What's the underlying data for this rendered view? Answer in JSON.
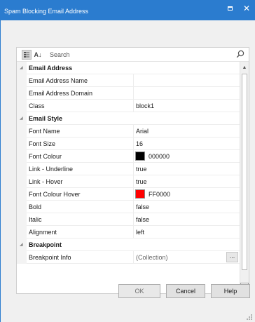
{
  "window": {
    "title": "Spam Blocking Email Address",
    "maximize_icon": "maximize-icon",
    "close_icon": "close-icon",
    "close_glyph": "✕"
  },
  "toolbar": {
    "categorized_icon": "categorized-view-icon",
    "alphabetical_icon": "sort-alphabetical-icon",
    "alphabetical_glyph": "A↓",
    "search_placeholder": "Search",
    "search_icon": "search-icon"
  },
  "categories": [
    {
      "label": "Email Address",
      "properties": [
        {
          "name": "Email Address Name",
          "value": ""
        },
        {
          "name": "Email Address Domain",
          "value": ""
        },
        {
          "name": "Class",
          "value": "block1"
        }
      ]
    },
    {
      "label": "Email Style",
      "properties": [
        {
          "name": "Font Name",
          "value": "Arial"
        },
        {
          "name": "Font Size",
          "value": "16"
        },
        {
          "name": "Font Colour",
          "value": "000000",
          "swatch": "#000000"
        },
        {
          "name": "Link - Underline",
          "value": "true"
        },
        {
          "name": "Link - Hover",
          "value": "true"
        },
        {
          "name": "Font Colour Hover",
          "value": "FF0000",
          "swatch": "#ff0000"
        },
        {
          "name": "Bold",
          "value": "false"
        },
        {
          "name": "Italic",
          "value": "false"
        },
        {
          "name": "Alignment",
          "value": "left"
        }
      ]
    },
    {
      "label": "Breakpoint",
      "properties": [
        {
          "name": "Breakpoint Info",
          "value": "(Collection)",
          "button": "..."
        }
      ]
    }
  ],
  "buttons": {
    "ok": "OK",
    "cancel": "Cancel",
    "help": "Help"
  },
  "colors": {
    "titlebar": "#2b7ccf",
    "dialog_background": "#f0f0f0"
  }
}
